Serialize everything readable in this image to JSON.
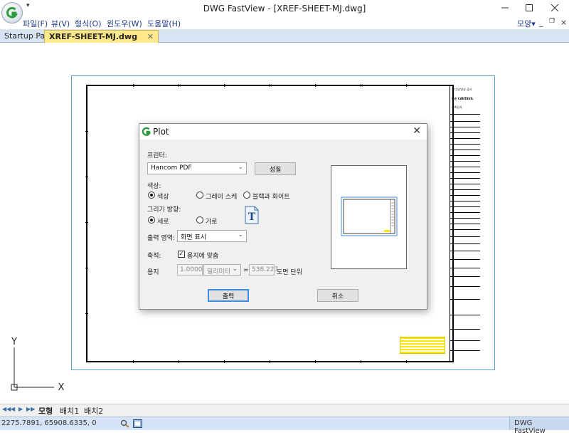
{
  "window": {
    "title": "DWG FastView - [XREF-SHEET-MJ.dwg]",
    "qat": "▾"
  },
  "menu": {
    "items": [
      "파일(F)",
      "뷰(V)",
      "형식(O)",
      "윈도우(W)",
      "도움말(H)"
    ],
    "right_label": "모양▾"
  },
  "tabs": [
    {
      "label": "Startup Page"
    },
    {
      "label": "XREF-SHEET-MJ.dwg",
      "close": "✕"
    }
  ],
  "dialog": {
    "title": "Plot",
    "printer_label": "프린터:",
    "printer_value": "Hancom PDF",
    "properties_button": "성질",
    "color_label": "색상:",
    "color_options": [
      "색상",
      "그레이 스케",
      "블랙과 화이트"
    ],
    "color_selected": 0,
    "orientation_label": "그리기 방향:",
    "orientation_options": [
      "세로",
      "가로"
    ],
    "orientation_selected": 0,
    "orientation_icon_letter": "T",
    "output_area_label": "출력 영역:",
    "output_area_value": "화면 표시",
    "scale_label": "축적:",
    "fit_to_paper_label": "용지에 맞춤",
    "fit_to_paper_checked": true,
    "paper_label": "용지",
    "paper_value": "1.0000",
    "unit_value": "밀리미터",
    "equals": "=",
    "drawing_units_value": "538.227",
    "drawing_units_label": "도면 단위",
    "print_button": "출력",
    "cancel_button": "취소"
  },
  "drawing": {
    "title_block_lines": [
      "오디오/영상 공사",
      "화순 CANTAVIL",
      "신축공사"
    ],
    "ucs_y": "Y",
    "ucs_x": "X"
  },
  "layout_tabs": [
    "모형",
    "배치1",
    "배치2"
  ],
  "layout_active": 0,
  "status": {
    "coords": "2275.7891, 65908.6335, 0",
    "app_name": "DWG FastView"
  }
}
